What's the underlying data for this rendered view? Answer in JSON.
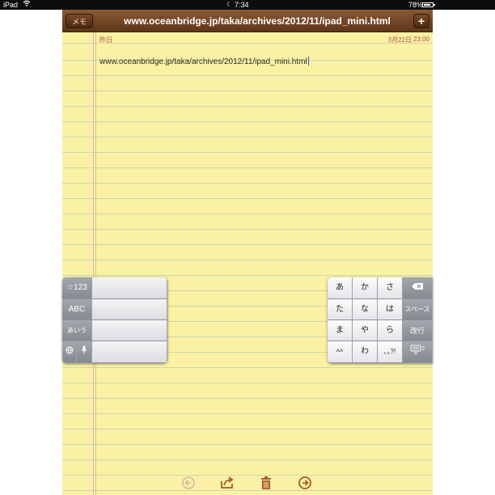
{
  "status_bar": {
    "device": "iPad",
    "time": "7:34",
    "battery": "78%",
    "battery_level": 0.78,
    "icons": [
      "wifi-icon",
      "moon-icon",
      "battery-icon"
    ]
  },
  "toolbar": {
    "memo_label": "メモ",
    "title": "www.oceanbridge.jp/taka/archives/2012/11/ipad_mini.html",
    "add_label": "+"
  },
  "note": {
    "day": "昨日",
    "date": "3月22日",
    "time": "23:00",
    "text": "www.oceanbridge.jp/taka/archives/2012/11/ipad_mini.html"
  },
  "keyboard_left": {
    "mode_keys": [
      "☆123",
      "ABC",
      "あいう"
    ],
    "globe_icon": "globe-icon",
    "mic_icon": "microphone-icon"
  },
  "keyboard_right": {
    "row1": [
      "あ",
      "か",
      "さ"
    ],
    "row2": [
      "た",
      "な",
      "は"
    ],
    "row3": [
      "ま",
      "や",
      "ら"
    ],
    "row4": [
      "^^",
      "わ",
      "､｡?!"
    ],
    "delete_icon": "delete-icon",
    "space_label": "スペース",
    "return_label": "改行",
    "hide_keyboard_icon": "keyboard-hide-icon"
  },
  "bottom_bar": {
    "icons": [
      "back-arrow-icon",
      "share-icon",
      "trash-icon",
      "forward-arrow-icon"
    ]
  },
  "colors": {
    "paper": "#faf1a4",
    "toolbar": "#6e4222",
    "accent_text": "#b3553a",
    "icon_brown": "#a35a2c"
  }
}
